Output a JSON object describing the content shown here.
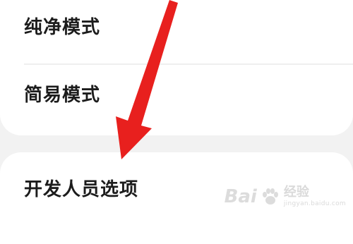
{
  "settings": {
    "items": [
      {
        "label": "纯净模式"
      },
      {
        "label": "简易模式"
      },
      {
        "label": "开发人员选项"
      }
    ]
  },
  "annotation": {
    "arrow_color": "#e8201e"
  },
  "watermark": {
    "logo": "Bai",
    "paw_icon": "paw-icon",
    "text_cn": "经验",
    "url": "jingyan.baidu.com"
  }
}
